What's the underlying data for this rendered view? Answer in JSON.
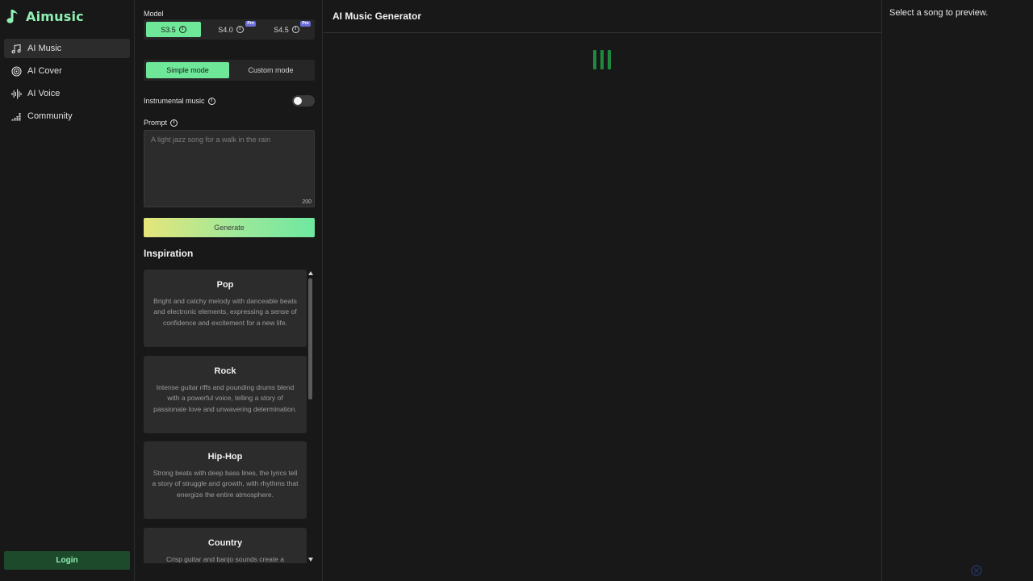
{
  "app": {
    "name": "Aimusic",
    "brand_color": "#8ff0b4",
    "accent_color": "#6ee898"
  },
  "sidebar": {
    "items": [
      {
        "label": "AI Music",
        "icon": "music-note-icon",
        "active": true
      },
      {
        "label": "AI Cover",
        "icon": "vinyl-icon",
        "active": false
      },
      {
        "label": "AI Voice",
        "icon": "waveform-icon",
        "active": false
      },
      {
        "label": "Community",
        "icon": "equalizer-icon",
        "active": false
      }
    ],
    "login_label": "Login"
  },
  "form": {
    "model_label": "Model",
    "models": [
      {
        "label": "S3.5",
        "active": true,
        "pro": false
      },
      {
        "label": "S4.0",
        "active": false,
        "pro": true
      },
      {
        "label": "S4.5",
        "active": false,
        "pro": true
      }
    ],
    "pro_badge": "Pro",
    "modes": [
      {
        "label": "Simple mode",
        "active": true
      },
      {
        "label": "Custom mode",
        "active": false
      }
    ],
    "instrumental_label": "Instrumental music",
    "instrumental_on": false,
    "prompt_label": "Prompt",
    "prompt_value": "",
    "prompt_placeholder": "A light jazz song for a walk in the rain",
    "prompt_counter": "200",
    "generate_label": "Generate"
  },
  "inspiration": {
    "title": "Inspiration",
    "cards": [
      {
        "title": "Pop",
        "desc": "Bright and catchy melody with danceable beats and electronic elements, expressing a sense of confidence and excitement for a new life."
      },
      {
        "title": "Rock",
        "desc": "Intense guitar riffs and pounding drums blend with a powerful voice, telling a story of passionate love and unwavering determination."
      },
      {
        "title": "Hip-Hop",
        "desc": "Strong beats with deep bass lines, the lyrics tell a story of struggle and growth, with rhythms that energize the entire atmosphere."
      },
      {
        "title": "Country",
        "desc": "Crisp guitar and banjo sounds create a"
      }
    ]
  },
  "main": {
    "title": "AI Music Generator",
    "loader_color": "#1f8a3f"
  },
  "preview": {
    "empty_text": "Select a song to preview."
  }
}
